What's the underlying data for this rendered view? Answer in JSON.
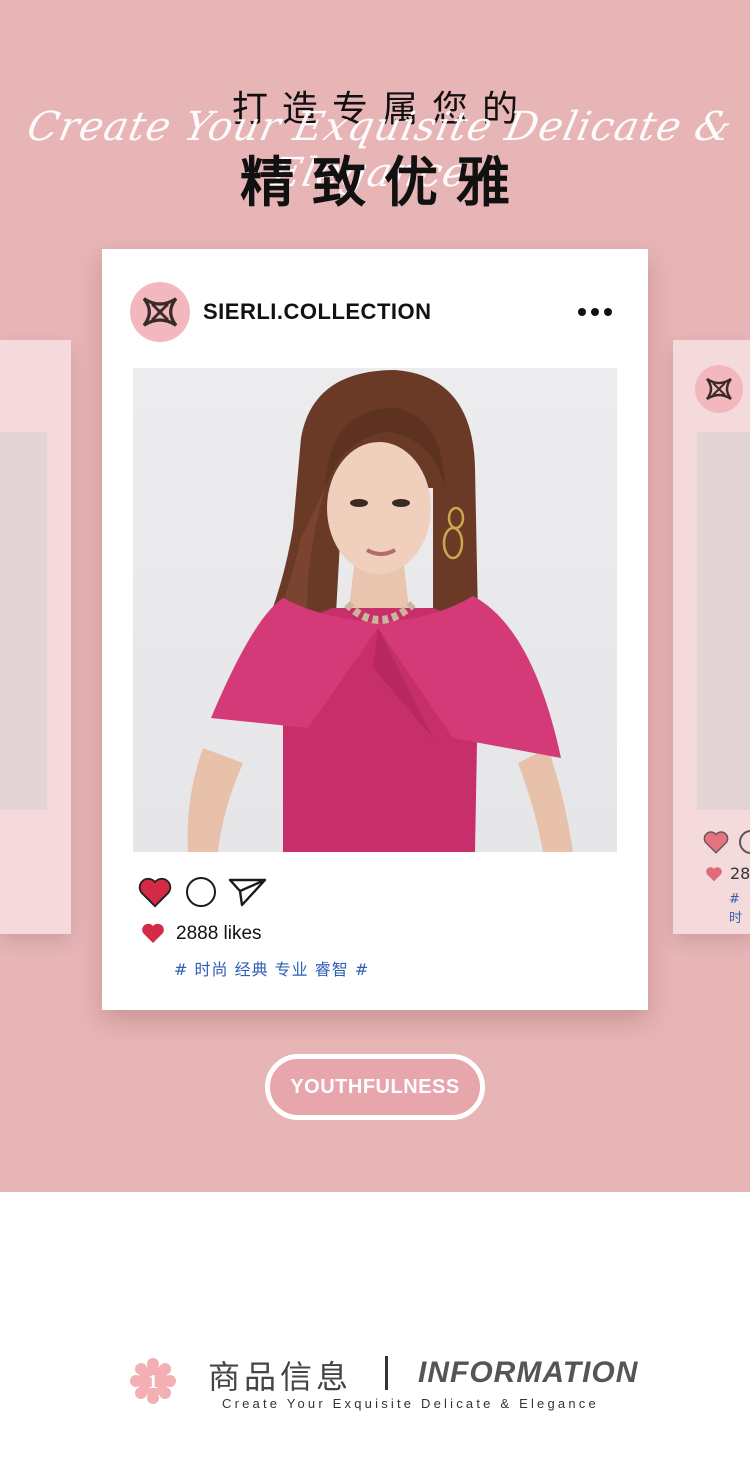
{
  "header": {
    "line1": "打造专属您的",
    "script": "Create Your Exquisite Delicate & Elegance",
    "line2": "精致优雅"
  },
  "post": {
    "account": "SIERLI.COLLECTION",
    "likes": "2888 likes",
    "tags": "# 时尚 经典 专业 睿智 #",
    "photo_alt": "model-wearing-fuchsia-cape-dress"
  },
  "side_card": {
    "likes_partial": "28",
    "tags_partial": "# 时"
  },
  "button": {
    "label": "YOUTHFULNESS"
  },
  "info": {
    "badge_number": "1",
    "title_cn": "商品信息",
    "title_en": "INFORMATION",
    "subtitle": "Create Your Exquisite Delicate & Elegance"
  },
  "colors": {
    "background_pink": "#e8b5b7",
    "card_white": "#ffffff",
    "heart_red": "#d42a46",
    "tag_blue": "#2f5fb5",
    "badge_pink": "#f2b0b4"
  },
  "icons": [
    "brand-logo-icon",
    "more-dots-icon",
    "heart-icon",
    "comment-icon",
    "share-icon",
    "flower-badge-icon"
  ]
}
